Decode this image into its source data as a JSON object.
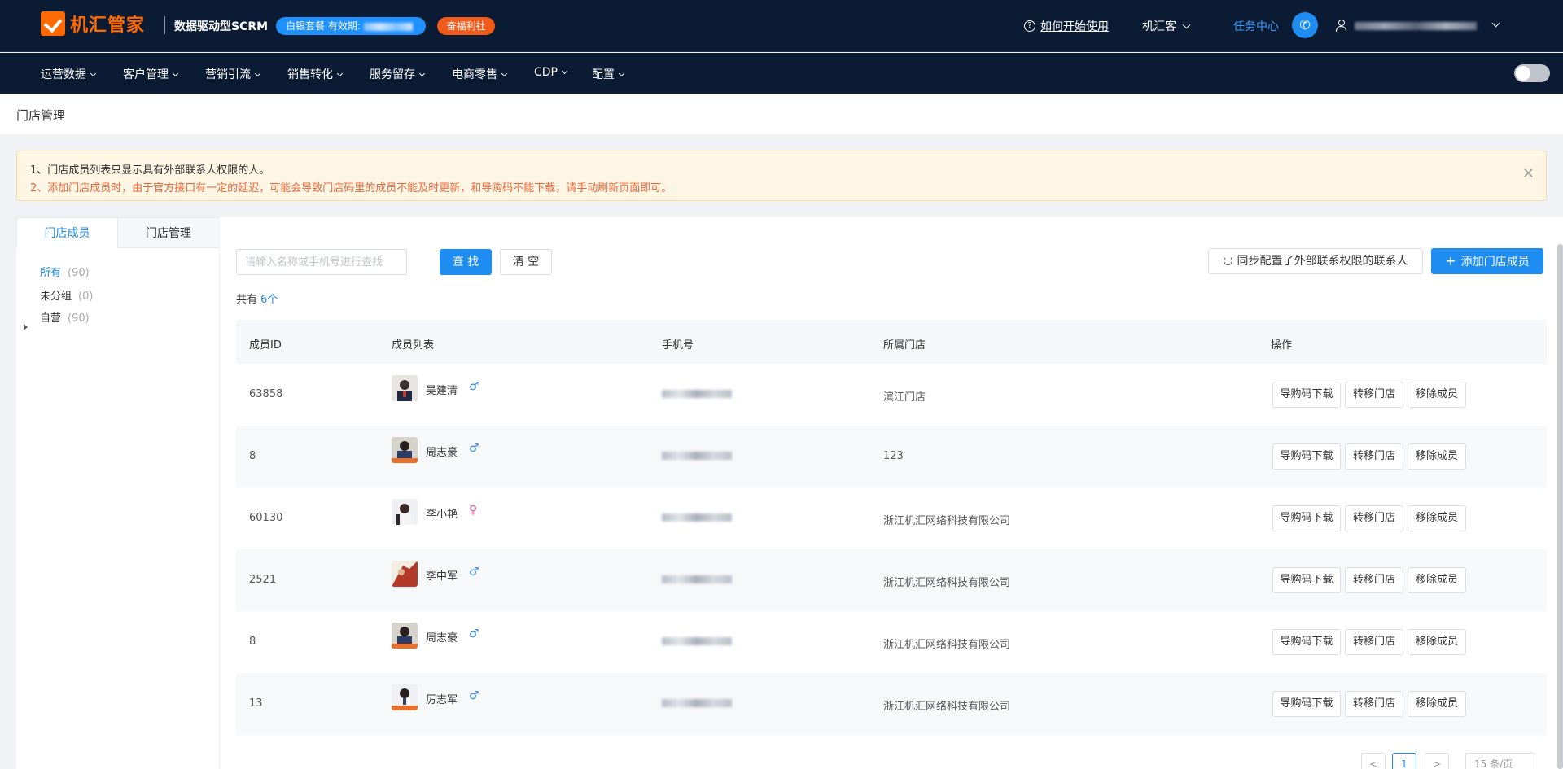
{
  "header": {
    "logo_text": "机汇管家",
    "subtitle": "数据驱动型SCRM",
    "package_badge": "白银套餐 有效期:",
    "welfare_badge": "奋福利社",
    "howto_label": "如何开始使用",
    "jhk_label": "机汇客",
    "task_center": "任务中心",
    "icons": [
      "question-icon",
      "phone-icon",
      "user-icon"
    ]
  },
  "nav": {
    "items": [
      "运营数据",
      "客户管理",
      "营销引流",
      "销售转化",
      "服务留存",
      "电商零售",
      "CDP",
      "配置"
    ]
  },
  "page": {
    "title": "门店管理"
  },
  "alert": {
    "line1": "1、门店成员列表只显示具有外部联系人权限的人。",
    "line2": "2、添加门店成员时，由于官方接口有一定的延迟，可能会导致门店码里的成员不能及时更新，和导购码不能下载，请手动刷新页面即可。",
    "close": "×"
  },
  "left": {
    "tabs": [
      "门店成员",
      "门店管理"
    ],
    "groups": [
      {
        "label": "所有",
        "count": "(90)"
      },
      {
        "label": "未分组",
        "count": "(0)"
      },
      {
        "label": "自营",
        "count": "(90)"
      }
    ]
  },
  "toolbar": {
    "search_placeholder": "请输入名称或手机号进行查找",
    "search_btn": "查 找",
    "clear_btn": "清 空",
    "sync_btn": "同步配置了外部联系权限的联系人",
    "add_btn": "添加门店成员",
    "total_prefix": "共有 ",
    "total_count": "6个"
  },
  "table": {
    "headers": [
      "成员ID",
      "成员列表",
      "手机号",
      "所属门店",
      "操作"
    ],
    "rows": [
      {
        "id": "63858",
        "name": "吴建清",
        "gender": "♂",
        "store": "滨江门店"
      },
      {
        "id": "8",
        "name": "周志豪",
        "gender": "♂",
        "store": "123"
      },
      {
        "id": "60130",
        "name": "李小艳",
        "gender": "♀",
        "store": "浙江机汇网络科技有限公司"
      },
      {
        "id": "2521",
        "name": "李中军",
        "gender": "♂",
        "store": "浙江机汇网络科技有限公司"
      },
      {
        "id": "8",
        "name": "周志豪",
        "gender": "♂",
        "store": "浙江机汇网络科技有限公司"
      },
      {
        "id": "13",
        "name": "厉志军",
        "gender": "♂",
        "store": "浙江机汇网络科技有限公司"
      }
    ],
    "actions": [
      "导购码下载",
      "转移门店",
      "移除成员"
    ]
  },
  "pagination": {
    "prev": "<",
    "current": "1",
    "next": ">",
    "size": "15 条/页"
  },
  "colors": {
    "header_bg": "#0b1b33",
    "brand_orange": "#ff6a00",
    "primary_blue": "#1e8cf0"
  }
}
